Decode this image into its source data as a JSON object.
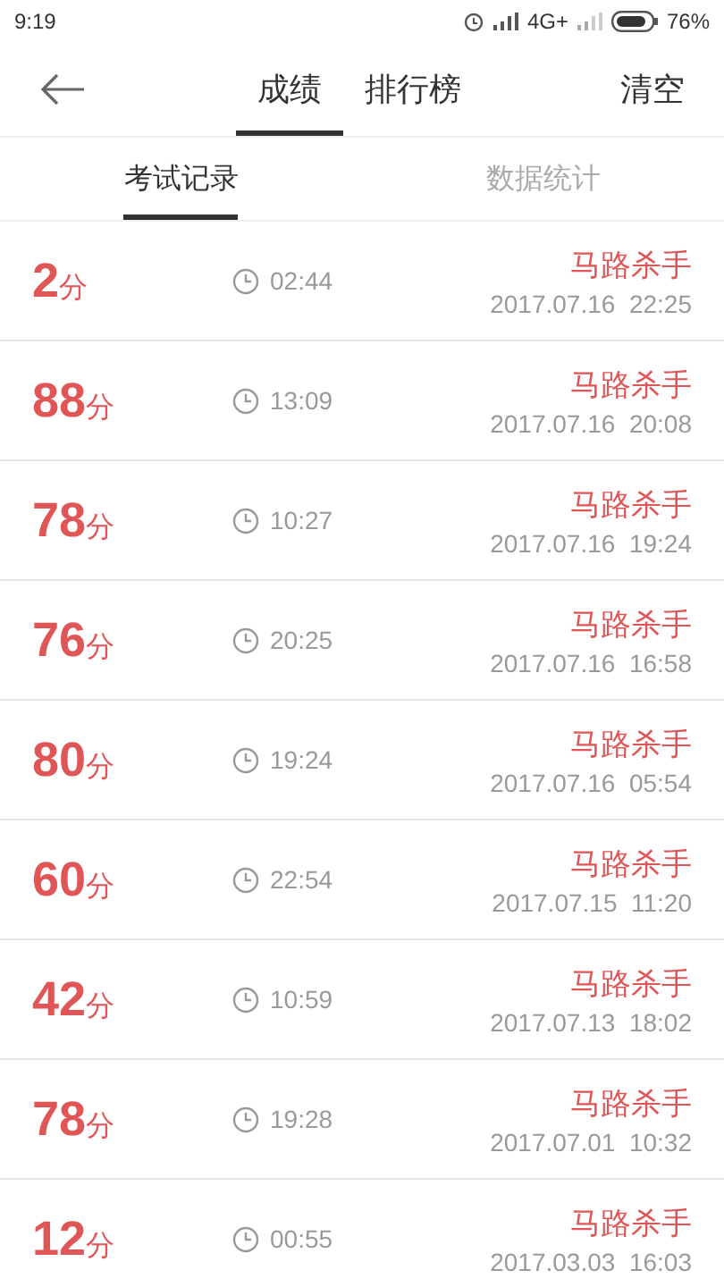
{
  "status_bar": {
    "time": "9:19",
    "network": "4G+",
    "battery": "76%"
  },
  "top_tabs": [
    {
      "label": "成绩",
      "selected": true
    },
    {
      "label": "排行榜",
      "selected": false
    }
  ],
  "clear_button": "清空",
  "sub_tabs": [
    {
      "label": "考试记录",
      "selected": true
    },
    {
      "label": "数据统计",
      "selected": false
    }
  ],
  "records": [
    {
      "score": "2",
      "unit": "分",
      "duration": "02:44",
      "title": "马路杀手",
      "date": "2017.07.16  22:25"
    },
    {
      "score": "88",
      "unit": "分",
      "duration": "13:09",
      "title": "马路杀手",
      "date": "2017.07.16  20:08"
    },
    {
      "score": "78",
      "unit": "分",
      "duration": "10:27",
      "title": "马路杀手",
      "date": "2017.07.16  19:24"
    },
    {
      "score": "76",
      "unit": "分",
      "duration": "20:25",
      "title": "马路杀手",
      "date": "2017.07.16  16:58"
    },
    {
      "score": "80",
      "unit": "分",
      "duration": "19:24",
      "title": "马路杀手",
      "date": "2017.07.16  05:54"
    },
    {
      "score": "60",
      "unit": "分",
      "duration": "22:54",
      "title": "马路杀手",
      "date": "2017.07.15  11:20"
    },
    {
      "score": "42",
      "unit": "分",
      "duration": "10:59",
      "title": "马路杀手",
      "date": "2017.07.13  18:02"
    },
    {
      "score": "78",
      "unit": "分",
      "duration": "19:28",
      "title": "马路杀手",
      "date": "2017.07.01  10:32"
    },
    {
      "score": "12",
      "unit": "分",
      "duration": "00:55",
      "title": "马路杀手",
      "date": "2017.03.03  16:03"
    }
  ]
}
